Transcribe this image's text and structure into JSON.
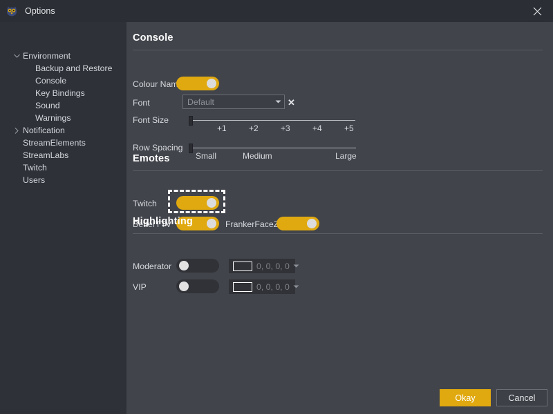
{
  "window": {
    "title": "Options",
    "app_icon": "owl-icon",
    "close_icon": "close-icon"
  },
  "sidebar": {
    "items": [
      {
        "label": "Environment",
        "level": 0,
        "twisty": "chevron-down-icon",
        "name": "sidebar-item-environment"
      },
      {
        "label": "Backup and Restore",
        "level": 1,
        "twisty": "",
        "name": "sidebar-item-backup-and-restore"
      },
      {
        "label": "Console",
        "level": 1,
        "twisty": "",
        "name": "sidebar-item-console"
      },
      {
        "label": "Key Bindings",
        "level": 1,
        "twisty": "",
        "name": "sidebar-item-key-bindings"
      },
      {
        "label": "Sound",
        "level": 1,
        "twisty": "",
        "name": "sidebar-item-sound"
      },
      {
        "label": "Warnings",
        "level": 1,
        "twisty": "",
        "name": "sidebar-item-warnings"
      },
      {
        "label": "Notification",
        "level": 0,
        "twisty": "chevron-right-icon",
        "name": "sidebar-item-notification"
      },
      {
        "label": "StreamElements",
        "level": 0,
        "twisty": "",
        "name": "sidebar-item-streamelements"
      },
      {
        "label": "StreamLabs",
        "level": 0,
        "twisty": "",
        "name": "sidebar-item-streamlabs"
      },
      {
        "label": "Twitch",
        "level": 0,
        "twisty": "",
        "name": "sidebar-item-twitch"
      },
      {
        "label": "Users",
        "level": 0,
        "twisty": "",
        "name": "sidebar-item-users"
      }
    ]
  },
  "sections": {
    "console": {
      "title": "Console"
    },
    "emotes": {
      "title": "Emotes"
    },
    "highlighting": {
      "title": "Highlighting"
    }
  },
  "console": {
    "colour_names": {
      "label": "Colour Names",
      "state": "on"
    },
    "font": {
      "label": "Font",
      "value": "Default",
      "placeholder": "Default",
      "clear_label": "✕"
    },
    "font_size": {
      "label": "Font Size",
      "value": 0,
      "ticks": [
        "+1",
        "+2",
        "+3",
        "+4",
        "+5"
      ]
    },
    "row_spacing": {
      "label": "Row Spacing",
      "value": 0,
      "ticks": [
        "Small",
        "Medium",
        "Large"
      ]
    }
  },
  "emotes": {
    "twitch": {
      "label": "Twitch",
      "state": "on"
    },
    "betterttv": {
      "label": "BetterTTV",
      "state": "on",
      "focused": true
    },
    "frankerfacez": {
      "label": "FrankerFaceZ",
      "state": "on"
    }
  },
  "highlighting": {
    "moderator": {
      "label": "Moderator",
      "state": "off",
      "colour": "0, 0, 0, 0"
    },
    "vip": {
      "label": "VIP",
      "state": "off",
      "colour": "0, 0, 0, 0"
    }
  },
  "footer": {
    "okay": "Okay",
    "cancel": "Cancel"
  },
  "colors": {
    "accent": "#e0a90f",
    "titlebar_bg": "#2b2e34",
    "sidebar_bg": "#2e3138",
    "panel_bg": "#41444b",
    "toggle_off_bg": "#303237",
    "focus_ring": "#ffffff"
  }
}
